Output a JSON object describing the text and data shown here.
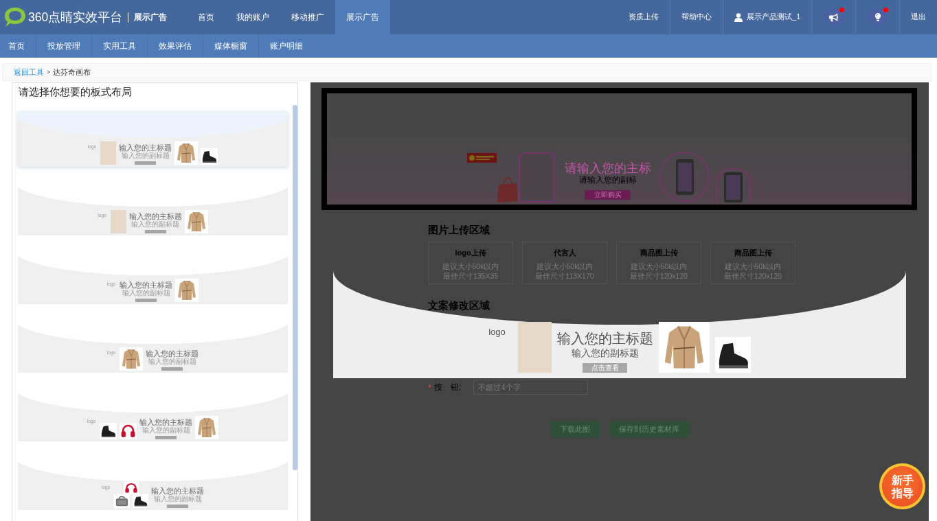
{
  "header": {
    "brand": "360点睛实效平台",
    "product": "展示广告",
    "nav": [
      {
        "label": "首页",
        "selected": false
      },
      {
        "label": "我的账户",
        "selected": false
      },
      {
        "label": "移动推广",
        "selected": false
      },
      {
        "label": "展示广告",
        "selected": true
      }
    ],
    "links": [
      {
        "kind": "link",
        "label": "资质上传"
      },
      {
        "kind": "link",
        "label": "帮助中心"
      },
      {
        "kind": "user",
        "label": "展示产品测试_1"
      },
      {
        "kind": "notice",
        "unread": true
      },
      {
        "kind": "tips",
        "unread": true
      },
      {
        "kind": "link",
        "label": "退出"
      }
    ]
  },
  "subnav": [
    "首页",
    "投放管理",
    "实用工具",
    "效果评估",
    "媒体橱窗",
    "账户明细"
  ],
  "breadcrumb": {
    "link": "返回工具",
    "separator": ">",
    "current": "达芬奇画布"
  },
  "layout_panel": {
    "title": "请选择你想要的板式布局",
    "layouts": [
      {
        "selected": true,
        "items": [
          {
            "kind": "logo",
            "text": "logo"
          },
          {
            "kind": "photo"
          },
          {
            "kind": "copy",
            "title": "输入您的主标题",
            "subtitle": "输入您的副标题"
          },
          {
            "kind": "coat"
          },
          {
            "kind": "shoe"
          }
        ]
      },
      {
        "selected": false,
        "items": [
          {
            "kind": "logo",
            "text": "logo"
          },
          {
            "kind": "photo"
          },
          {
            "kind": "copy",
            "title": "输入您的主标题",
            "subtitle": "输入您的副标题"
          },
          {
            "kind": "coat"
          }
        ]
      },
      {
        "selected": false,
        "items": [
          {
            "kind": "logo",
            "text": "logo"
          },
          {
            "kind": "copy",
            "title": "输入您的主标题",
            "subtitle": "输入您的副标题"
          },
          {
            "kind": "coat"
          }
        ]
      },
      {
        "selected": false,
        "items": [
          {
            "kind": "logo",
            "text": "logo"
          },
          {
            "kind": "coat"
          },
          {
            "kind": "copy",
            "title": "输入您的主标题",
            "subtitle": "输入您的副标题"
          }
        ]
      },
      {
        "selected": false,
        "items": [
          {
            "kind": "logo",
            "text": "logo"
          },
          {
            "kind": "shoe"
          },
          {
            "kind": "headphones"
          },
          {
            "kind": "copy",
            "title": "输入您的主标题",
            "subtitle": "输入您的副标题"
          },
          {
            "kind": "coat"
          }
        ]
      },
      {
        "selected": false,
        "items": [
          {
            "kind": "logo",
            "text": "logo"
          },
          {
            "kind": "stack",
            "items": [
              {
                "kind": "headphones"
              },
              {
                "kind": "bag"
              },
              {
                "kind": "shoe"
              }
            ]
          },
          {
            "kind": "copy",
            "title": "输入您的主标题",
            "subtitle": "输入您的副标题"
          }
        ]
      }
    ]
  },
  "guide_mask": {
    "on": true
  },
  "editor": {
    "banner": {
      "title": "请输入您的主标",
      "subtitle": "请输入您的副标",
      "button": "立即购买"
    },
    "upload": {
      "title": "图片上传区域",
      "slots": [
        {
          "title": "logo上传",
          "size_hint": "建议大小50k以内",
          "dimension_hint": "最佳尺寸135X35"
        },
        {
          "title": "代言人",
          "size_hint": "建议大小50k以内",
          "dimension_hint": "最佳尺寸113X170"
        },
        {
          "title": "商品图上传",
          "size_hint": "建议大小50k以内",
          "dimension_hint": "最佳尺寸120x120"
        },
        {
          "title": "商品图上传",
          "size_hint": "建议大小50k以内",
          "dimension_hint": "最佳尺寸120x120"
        }
      ]
    },
    "copy_title": "文案修改区域",
    "field": {
      "mark": "*",
      "label": "按　钮:",
      "placeholder": "不超过4个字"
    },
    "actions": [
      "下载此图",
      "保存到历史素材库"
    ]
  },
  "drag_preview": {
    "items": [
      {
        "kind": "logo",
        "text": "logo"
      },
      {
        "kind": "photo"
      },
      {
        "kind": "copy",
        "title": "输入您的主标题",
        "subtitle": "输入您的副标题",
        "button": "点击查看"
      },
      {
        "kind": "coat"
      },
      {
        "kind": "shoe"
      }
    ]
  },
  "guide_button": {
    "label": "新手指导"
  }
}
